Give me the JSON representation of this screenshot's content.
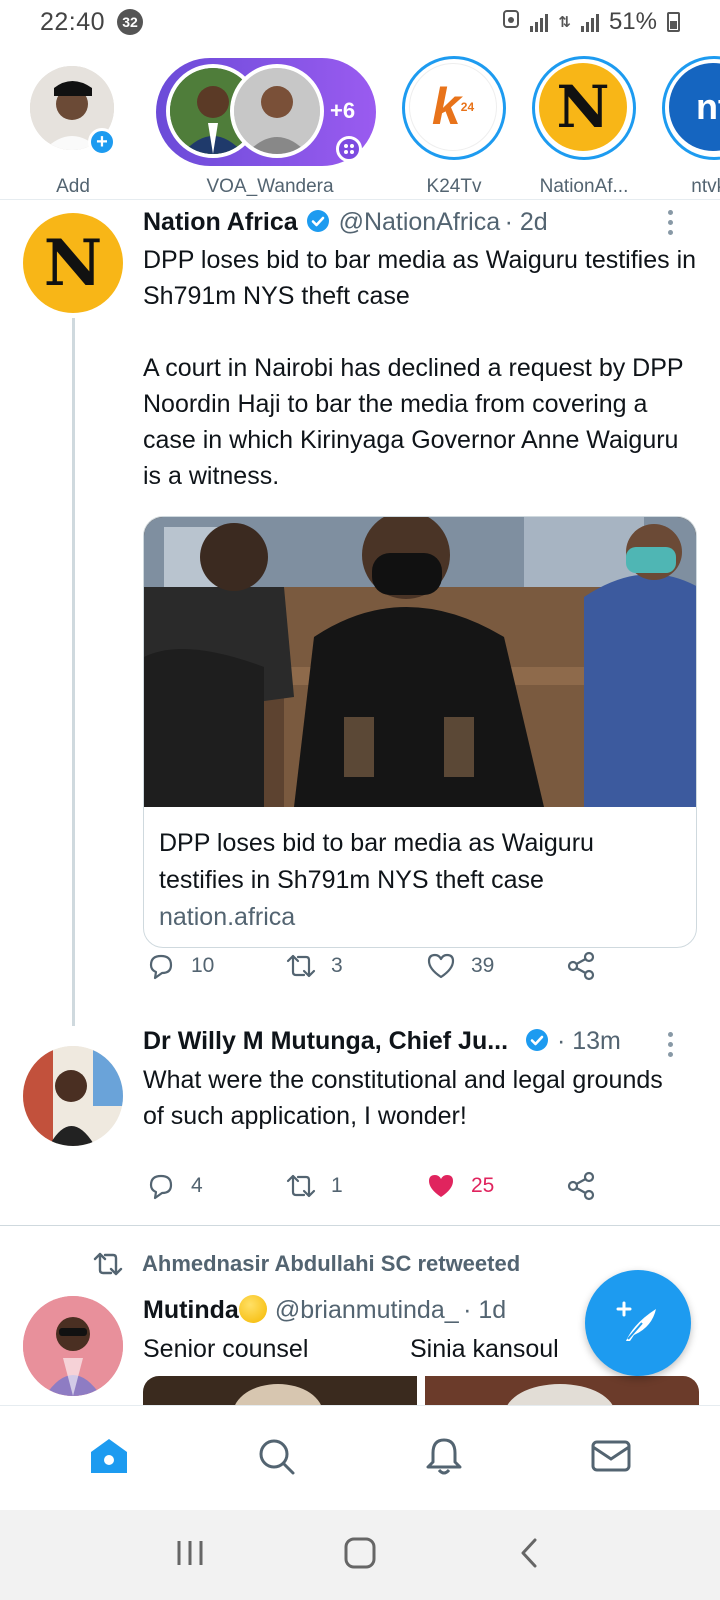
{
  "status_bar": {
    "time": "22:40",
    "notification_count": "32",
    "battery": "51%"
  },
  "fleets": [
    {
      "label": "Add"
    },
    {
      "label": "VOA_Wandera",
      "extra_count": "+6"
    },
    {
      "label": "K24Tv",
      "logo_text": "k",
      "logo_sup": "24"
    },
    {
      "label": "NationAf...",
      "logo_text": "N"
    },
    {
      "label": "ntvke",
      "logo_text": "nt"
    }
  ],
  "tweets": [
    {
      "name": "Nation Africa",
      "handle": "@NationAfrica",
      "time": "· 2d",
      "avatar_text": "N",
      "headline": "DPP loses bid to bar media as Waiguru testifies in Sh791m NYS theft case",
      "text": "A court in Nairobi has declined a request by DPP Noordin Haji to bar the media from covering a case in which Kirinyaga Governor Anne Waiguru is a witness.",
      "card": {
        "title": "DPP loses bid to bar media as Waiguru testifies in Sh791m NYS theft case",
        "domain": "nation.africa"
      },
      "replies": "10",
      "retweets": "3",
      "likes": "39"
    },
    {
      "name": "Dr Willy M Mutunga, Chief Ju...",
      "time": "· 13m",
      "text": "What were the constitutional and legal grounds of such application, I wonder!",
      "replies": "4",
      "retweets": "1",
      "likes": "25"
    },
    {
      "retweeted_by": "Ahmednasir Abdullahi SC retweeted",
      "name": "Mutinda",
      "handle": "@brianmutinda_",
      "time": "· 1d",
      "text_left": "Senior counsel",
      "text_right": "Sinia kansoul"
    }
  ],
  "colors": {
    "accent": "#1d9bf0",
    "like": "#e0245e",
    "muted": "#536471",
    "nation_yellow": "#f8b617"
  },
  "icons": {
    "nav": [
      "home-icon",
      "search-icon",
      "bell-icon",
      "mail-icon"
    ],
    "system_nav": [
      "recents-icon",
      "home-square-icon",
      "back-icon"
    ]
  }
}
